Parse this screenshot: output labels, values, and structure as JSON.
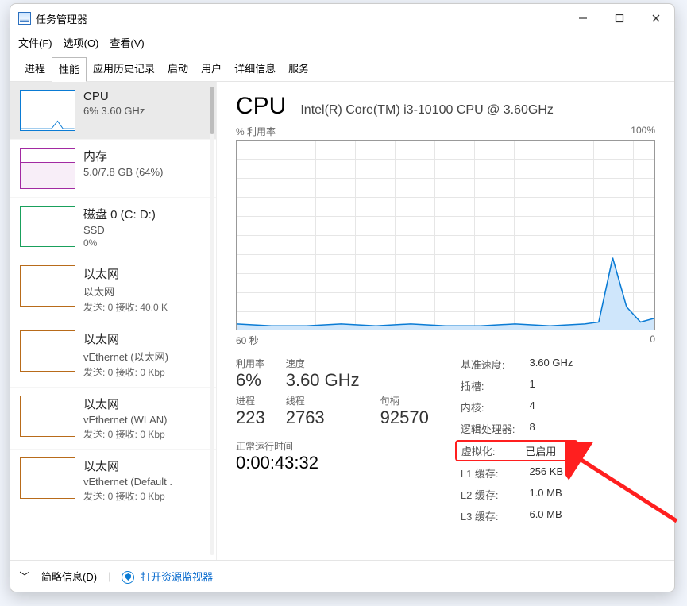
{
  "window": {
    "title": "任务管理器"
  },
  "menu": {
    "file": "文件(F)",
    "options": "选项(O)",
    "view": "查看(V)"
  },
  "tabs": {
    "processes": "进程",
    "performance": "性能",
    "app_history": "应用历史记录",
    "startup": "启动",
    "users": "用户",
    "details": "详细信息",
    "services": "服务"
  },
  "sidebar": [
    {
      "name": "CPU",
      "sub1": "6% 3.60 GHz",
      "kind": "cpu"
    },
    {
      "name": "内存",
      "sub1": "5.0/7.8 GB (64%)",
      "kind": "mem"
    },
    {
      "name": "磁盘 0 (C: D:)",
      "sub1": "SSD",
      "sub2": "0%",
      "kind": "disk"
    },
    {
      "name": "以太网",
      "sub1": "以太网",
      "sub2": "发送: 0 接收: 40.0 K",
      "kind": "net"
    },
    {
      "name": "以太网",
      "sub1": "vEthernet (以太网)",
      "sub2": "发送: 0 接收: 0 Kbp",
      "kind": "net"
    },
    {
      "name": "以太网",
      "sub1": "vEthernet (WLAN)",
      "sub2": "发送: 0 接收: 0 Kbp",
      "kind": "net"
    },
    {
      "name": "以太网",
      "sub1": "vEthernet (Default .",
      "sub2": "发送: 0 接收: 0 Kbp",
      "kind": "net"
    }
  ],
  "header": {
    "title": "CPU",
    "sub": "Intel(R) Core(TM) i3-10100 CPU @ 3.60GHz"
  },
  "chart": {
    "top_left": "% 利用率",
    "top_right": "100%",
    "bottom_left": "60 秒",
    "bottom_right": "0"
  },
  "stats_left": {
    "util_label": "利用率",
    "util": "6%",
    "speed_label": "速度",
    "speed": "3.60 GHz",
    "proc_label": "进程",
    "proc": "223",
    "threads_label": "线程",
    "threads": "2763",
    "handles_label": "句柄",
    "handles": "92570",
    "uptime_label": "正常运行时间",
    "uptime": "0:00:43:32"
  },
  "stats_right": {
    "base_speed_k": "基准速度:",
    "base_speed_v": "3.60 GHz",
    "sockets_k": "插槽:",
    "sockets_v": "1",
    "cores_k": "内核:",
    "cores_v": "4",
    "logical_k": "逻辑处理器:",
    "logical_v": "8",
    "virt_k": "虚拟化:",
    "virt_v": "已启用",
    "l1_k": "L1 缓存:",
    "l1_v": "256 KB",
    "l2_k": "L2 缓存:",
    "l2_v": "1.0 MB",
    "l3_k": "L3 缓存:",
    "l3_v": "6.0 MB"
  },
  "bottombar": {
    "brief": "简略信息(D)",
    "resmon": "打开资源监视器"
  },
  "chart_data": {
    "type": "line",
    "title": "% 利用率",
    "xlabel": "seconds",
    "ylabel": "percent",
    "xlim_seconds": [
      60,
      0
    ],
    "ylim": [
      0,
      100
    ],
    "series": [
      {
        "name": "CPU 利用率",
        "x_seconds_ago": [
          60,
          55,
          50,
          45,
          40,
          35,
          30,
          25,
          20,
          15,
          10,
          8,
          6,
          4,
          2,
          0
        ],
        "y_percent": [
          3,
          2,
          2,
          3,
          2,
          3,
          2,
          2,
          3,
          2,
          3,
          4,
          38,
          12,
          4,
          6
        ]
      }
    ]
  }
}
